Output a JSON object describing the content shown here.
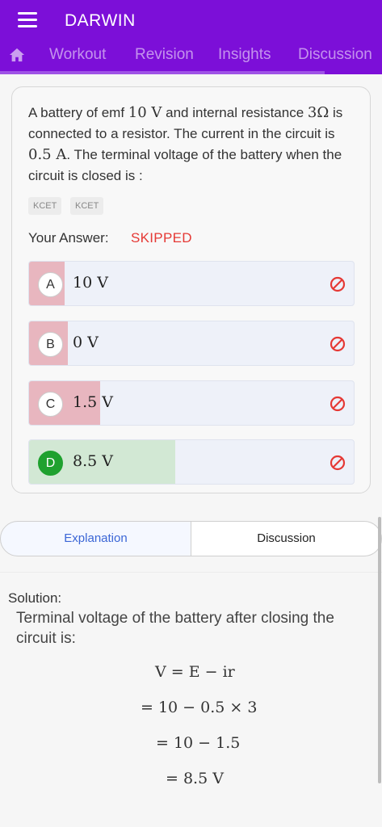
{
  "app": {
    "title": "DARWIN"
  },
  "tabs": [
    "Workout",
    "Revision",
    "Insights",
    "Discussion"
  ],
  "question": {
    "text_parts": {
      "p1": "A battery of emf ",
      "m1": "10 V",
      "p2": " and internal resistance ",
      "m2": "3Ω",
      "p3": " is connected to a resistor. The current in the circuit is ",
      "m3": "0.5 A",
      "p4": ". The terminal voltage of the battery when the circuit is closed is :"
    },
    "tags": [
      "KCET",
      "KCET"
    ],
    "your_answer_label": "Your Answer:",
    "your_answer_value": "SKIPPED"
  },
  "options": [
    {
      "letter": "A",
      "text": "10 V",
      "share": 0.11,
      "status": "incorrect"
    },
    {
      "letter": "B",
      "text": "0 V",
      "share": 0.12,
      "status": "incorrect"
    },
    {
      "letter": "C",
      "text": "1.5 V",
      "share": 0.22,
      "status": "incorrect"
    },
    {
      "letter": "D",
      "text": "8.5 V",
      "share": 0.45,
      "status": "correct"
    }
  ],
  "colors": {
    "header": "#7c0fd8",
    "incorrect_fill": "#e8b6bf",
    "correct_fill": "#d2e8d4",
    "correct_badge": "#1fa12f",
    "skipped": "#e53935",
    "ban_icon": "#e53935"
  },
  "icons": {
    "menu": "hamburger-icon",
    "home": "home-icon",
    "option_status": "ban-icon"
  },
  "segments": {
    "explanation": "Explanation",
    "discussion": "Discussion"
  },
  "solution": {
    "heading": "Solution:",
    "intro": "Terminal voltage of the battery after closing the circuit is:",
    "steps": [
      "V = E − ir",
      "= 10 − 0.5 × 3",
      "= 10 − 1.5",
      "= 8.5 V"
    ]
  }
}
